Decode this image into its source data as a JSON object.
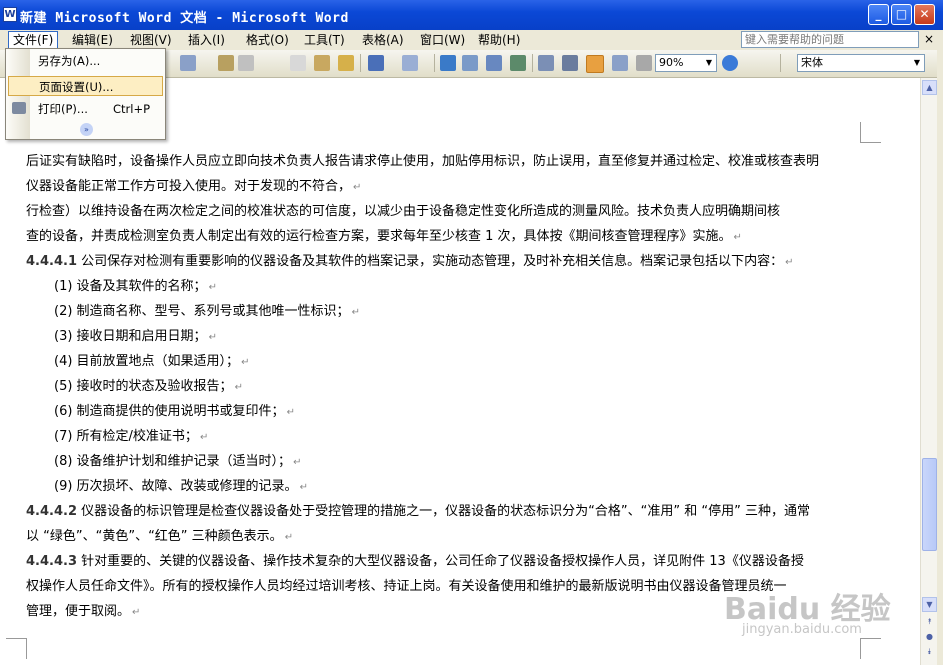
{
  "window": {
    "title": "新建 Microsoft Word 文档 - Microsoft Word",
    "min_glyph": "_",
    "max_glyph": "□",
    "close_glyph": "✕"
  },
  "menubar": {
    "items": [
      "文件(F)",
      "编辑(E)",
      "视图(V)",
      "插入(I)",
      "格式(O)",
      "工具(T)",
      "表格(A)",
      "窗口(W)",
      "帮助(H)"
    ],
    "help_placeholder": "键入需要帮助的问题",
    "help_close": "×"
  },
  "toolbar": {
    "zoom": "90%",
    "font": "宋体"
  },
  "file_menu": {
    "items": [
      {
        "label": "另存为(A)...",
        "shortcut": ""
      },
      {
        "label": "页面设置(U)...",
        "shortcut": ""
      },
      {
        "label": "打印(P)...",
        "shortcut": "Ctrl+P"
      }
    ],
    "expand_glyph": "»"
  },
  "document": {
    "paragraph_mark": "↵",
    "lines": [
      {
        "num": "",
        "text": "后证实有缺陷时，设备操作人员应立即向技术负责人报告请求停止使用，加贴停用标识，防止误用，直至修复并通过检定、校准或核查表明"
      },
      {
        "num": "",
        "text": "仪器设备能正常工作方可投入使用。对于发现的不符合，"
      },
      {
        "num": "",
        "text": "行检查）以维持设备在两次检定之间的校准状态的可信度，以减少由于设备稳定性变化所造成的测量风险。技术负责人应明确期间核"
      },
      {
        "num": "",
        "text": "查的设备，并责成检测室负责人制定出有效的运行检查方案，要求每年至少核查 1 次，具体按《期间核查管理程序》实施。"
      },
      {
        "num": "4.4.4.1",
        "text": "公司保存对检测有重要影响的仪器设备及其软件的档案记录，实施动态管理，及时补充相关信息。档案记录包括以下内容："
      },
      {
        "num": "",
        "text": "(1)  设备及其软件的名称；"
      },
      {
        "num": "",
        "text": "(2)  制造商名称、型号、系列号或其他唯一性标识；"
      },
      {
        "num": "",
        "text": "(3)  接收日期和启用日期；"
      },
      {
        "num": "",
        "text": "(4)  目前放置地点（如果适用）；"
      },
      {
        "num": "",
        "text": "(5)  接收时的状态及验收报告；"
      },
      {
        "num": "",
        "text": "(6)  制造商提供的使用说明书或复印件；"
      },
      {
        "num": "",
        "text": "(7)  所有检定/校准证书；"
      },
      {
        "num": "",
        "text": "(8)  设备维护计划和维护记录（适当时）；"
      },
      {
        "num": "",
        "text": "(9)  历次损坏、故障、改装或修理的记录。"
      },
      {
        "num": "4.4.4.2",
        "text": "仪器设备的标识管理是检查仪器设备处于受控管理的措施之一，仪器设备的状态标识分为“合格”、“准用” 和 “停用” 三种，通常"
      },
      {
        "num": "",
        "text": "以 “绿色”、“黄色”、“红色” 三种颜色表示。"
      },
      {
        "num": "4.4.4.3",
        "text": "针对重要的、关键的仪器设备、操作技术复杂的大型仪器设备，公司任命了仪器设备授权操作人员，详见附件 13《仪器设备授"
      },
      {
        "num": "",
        "text": "权操作人员任命文件》。所有的授权操作人员均经过培训考核、持证上岗。有关设备使用和维护的最新版说明书由仪器设备管理员统一"
      },
      {
        "num": "",
        "text": "管理，便于取阅。"
      }
    ]
  },
  "watermark": {
    "logo": "Baidu 经验",
    "url": "jingyan.baidu.com"
  },
  "colors": {
    "titlebar": "#0b48d6",
    "menu_highlight": "#fdeec3",
    "accent_border": "#316ac5"
  }
}
